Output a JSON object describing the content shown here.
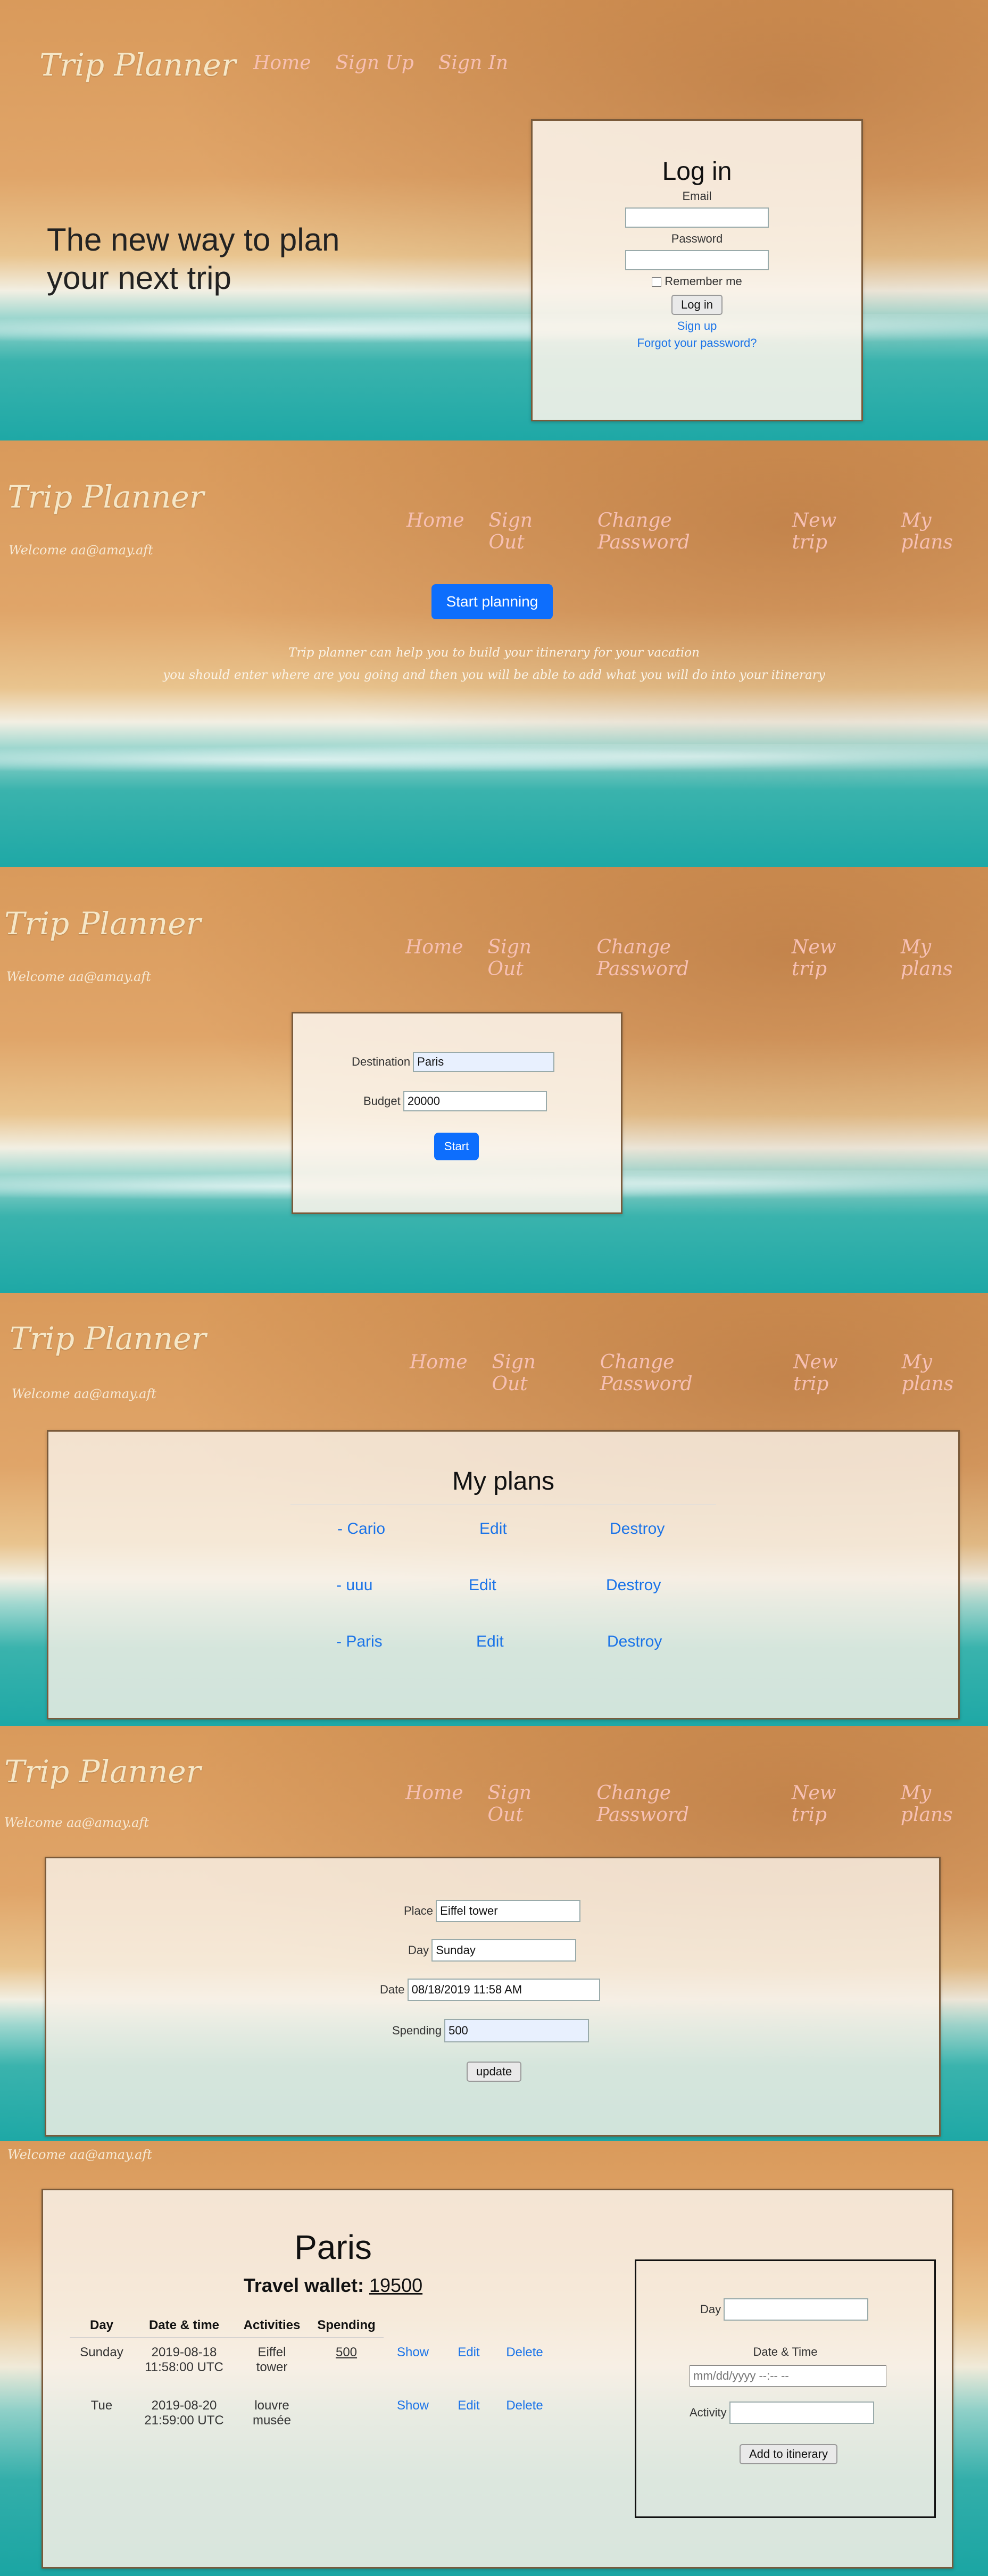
{
  "brand": "Trip Planner",
  "welcome": "Welcome aa@amay.aft",
  "section1": {
    "nav": [
      "Home",
      "Sign Up",
      "Sign In"
    ],
    "hero_line1": "The new way to plan",
    "hero_line2": "your next trip",
    "login": {
      "title": "Log in",
      "email_label": "Email",
      "password_label": "Password",
      "remember_label": "Remember me",
      "submit": "Log in",
      "signup_link": "Sign up",
      "forgot_link": "Forgot your password?"
    }
  },
  "nav_logged_in": [
    "Home",
    "Sign Out",
    "Change Password",
    "New trip",
    "My plans"
  ],
  "section2": {
    "start_button": "Start planning",
    "desc_line1": "Trip planner can help you to build your itinerary for your vacation",
    "desc_line2": "you should enter where are you going and then you will be able to add what you will do into your itinerary"
  },
  "section3": {
    "destination_label": "Destination",
    "destination_value": "Paris",
    "budget_label": "Budget",
    "budget_value": "20000",
    "start_button": "Start"
  },
  "section4": {
    "title": "My plans",
    "plans": [
      {
        "name": "- Cario",
        "edit": "Edit",
        "destroy": "Destroy"
      },
      {
        "name": "- uuu",
        "edit": "Edit",
        "destroy": "Destroy"
      },
      {
        "name": "- Paris",
        "edit": "Edit",
        "destroy": "Destroy"
      }
    ]
  },
  "section5": {
    "place_label": "Place",
    "place_value": "Eiffel tower",
    "day_label": "Day",
    "day_value": "Sunday",
    "date_label": "Date",
    "date_value": "08/18/2019 11:58 AM",
    "spending_label": "Spending",
    "spending_value": "500",
    "update_button": "update"
  },
  "section6": {
    "title": "Paris",
    "wallet_label": "Travel wallet:",
    "wallet_value": "19500",
    "headers": [
      "Day",
      "Date & time",
      "Activities",
      "Spending"
    ],
    "rows": [
      {
        "day": "Sunday",
        "date1": "2019-08-18",
        "date2": "11:58:00 UTC",
        "act1": "Eiffel",
        "act2": "tower",
        "spending": "500",
        "show": "Show",
        "edit": "Edit",
        "delete": "Delete"
      },
      {
        "day": "Tue",
        "date1": "2019-08-20",
        "date2": "21:59:00 UTC",
        "act1": "louvre",
        "act2": "musée",
        "spending": "",
        "show": "Show",
        "edit": "Edit",
        "delete": "Delete"
      }
    ],
    "form": {
      "day_label": "Day",
      "datetime_label": "Date & Time",
      "datetime_placeholder": "mm/dd/yyyy --:-- --",
      "activity_label": "Activity",
      "submit": "Add to itinerary"
    }
  },
  "colors": {
    "accent": "#0d6efd",
    "link": "#1a73e8",
    "nav": "#f7c0b4",
    "brand": "#f6e7c7"
  }
}
